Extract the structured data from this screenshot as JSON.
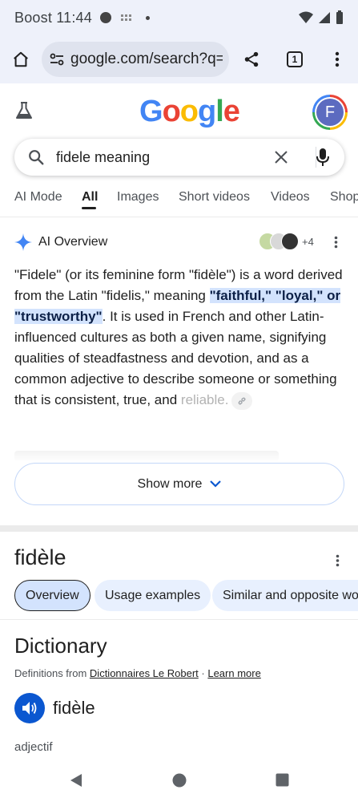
{
  "status_bar": {
    "carrier_time": "Boost 11:44"
  },
  "browser": {
    "url": "google.com/search?q=fi",
    "tab_count": "1",
    "icons": [
      "home-icon",
      "site-settings-icon",
      "share-icon",
      "tabs-icon",
      "more-vert-icon"
    ]
  },
  "google": {
    "logo": "Google",
    "avatar_letter": "F",
    "search_query": "fidele meaning"
  },
  "tabs": [
    {
      "label": "AI Mode",
      "active": false
    },
    {
      "label": "All",
      "active": true
    },
    {
      "label": "Images",
      "active": false
    },
    {
      "label": "Short videos",
      "active": false
    },
    {
      "label": "Videos",
      "active": false
    },
    {
      "label": "Shop",
      "active": false
    }
  ],
  "ai_overview": {
    "title": "AI Overview",
    "sources_more": "+4",
    "text_before": "\"Fidele\" (or its feminine form \"fidèle\") is a word derived from the Latin \"fidelis,\" meaning ",
    "highlight": "\"faithful,\" \"loyal,\" or \"trustworthy\"",
    "text_after": ". It is used in French and other Latin-influenced cultures as both a given name, signifying qualities of steadfastness and devotion, and as a common adjective to describe someone or something that is consistent, true, and ",
    "text_faded": "reliable.",
    "show_more": "Show more"
  },
  "word_panel": {
    "title": "fidèle",
    "chips": [
      {
        "label": "Overview",
        "active": true
      },
      {
        "label": "Usage examples",
        "active": false
      },
      {
        "label": "Similar and opposite words",
        "active": false
      }
    ]
  },
  "dictionary": {
    "title": "Dictionary",
    "from_prefix": "Definitions from ",
    "source": "Dictionnaires Le Robert",
    "separator": " · ",
    "learn_more": "Learn more",
    "headword": "fidèle",
    "part_of_speech": "adjectif"
  },
  "colors": {
    "chrome_bg": "#eef1fa",
    "highlight_bg": "#d3e3fd",
    "chip_bg": "#e8f0fe",
    "accent_blue": "#0b57d0"
  }
}
